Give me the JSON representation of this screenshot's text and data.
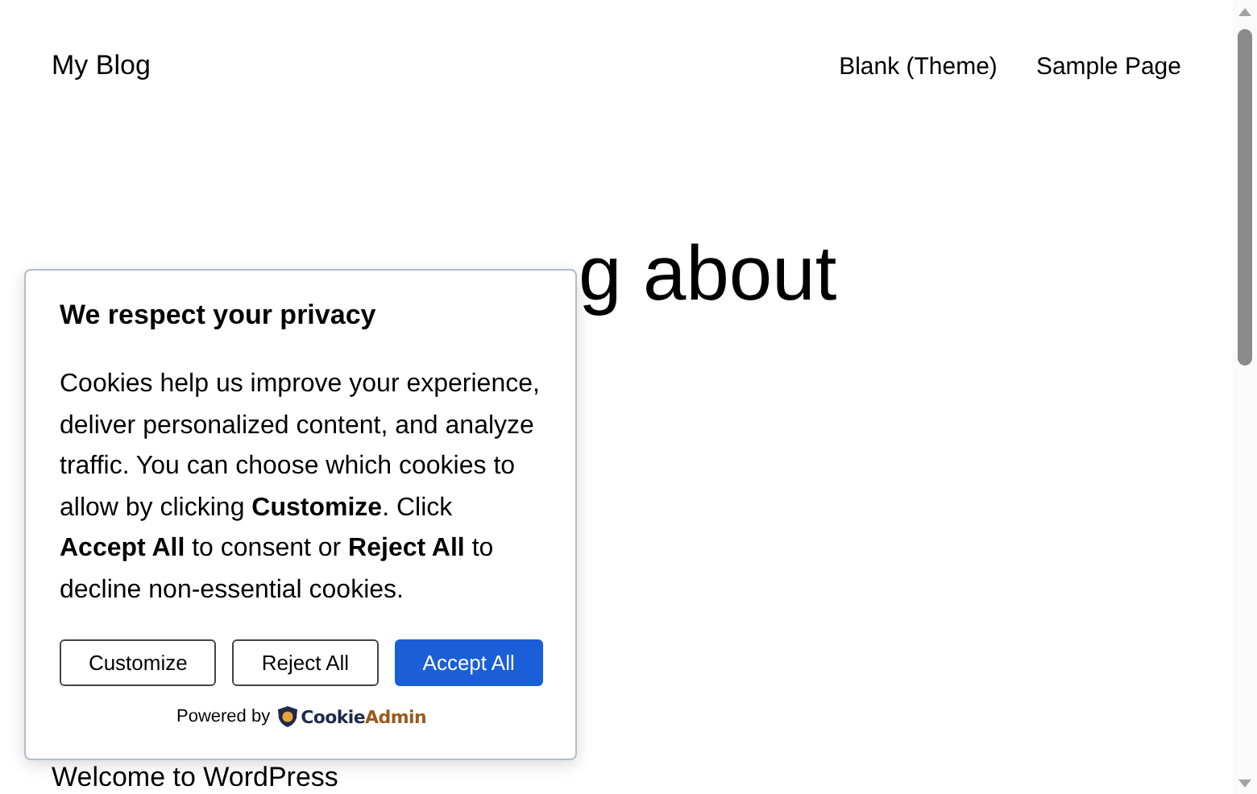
{
  "site_title": "My Blog",
  "nav": [
    {
      "label": "Blank (Theme)"
    },
    {
      "label": "Sample Page"
    }
  ],
  "heading": "g about",
  "post_title": "Welcome to WordPress",
  "cookie_banner": {
    "title": "We respect your privacy",
    "text": "Cookies help us improve your experience, deliver personalized content, and analyze traffic. You can choose which cookies to allow by clicking **Customize**. Click **Accept All** to consent or **Reject All** to decline non-essential cookies.",
    "buttons": [
      {
        "label": "Customize",
        "kind": "secondary"
      },
      {
        "label": "Reject All",
        "kind": "secondary"
      },
      {
        "label": "Accept All",
        "kind": "primary"
      }
    ],
    "powered_by": "Powered by",
    "brand_first": "Cookie",
    "brand_second": "Admin"
  }
}
